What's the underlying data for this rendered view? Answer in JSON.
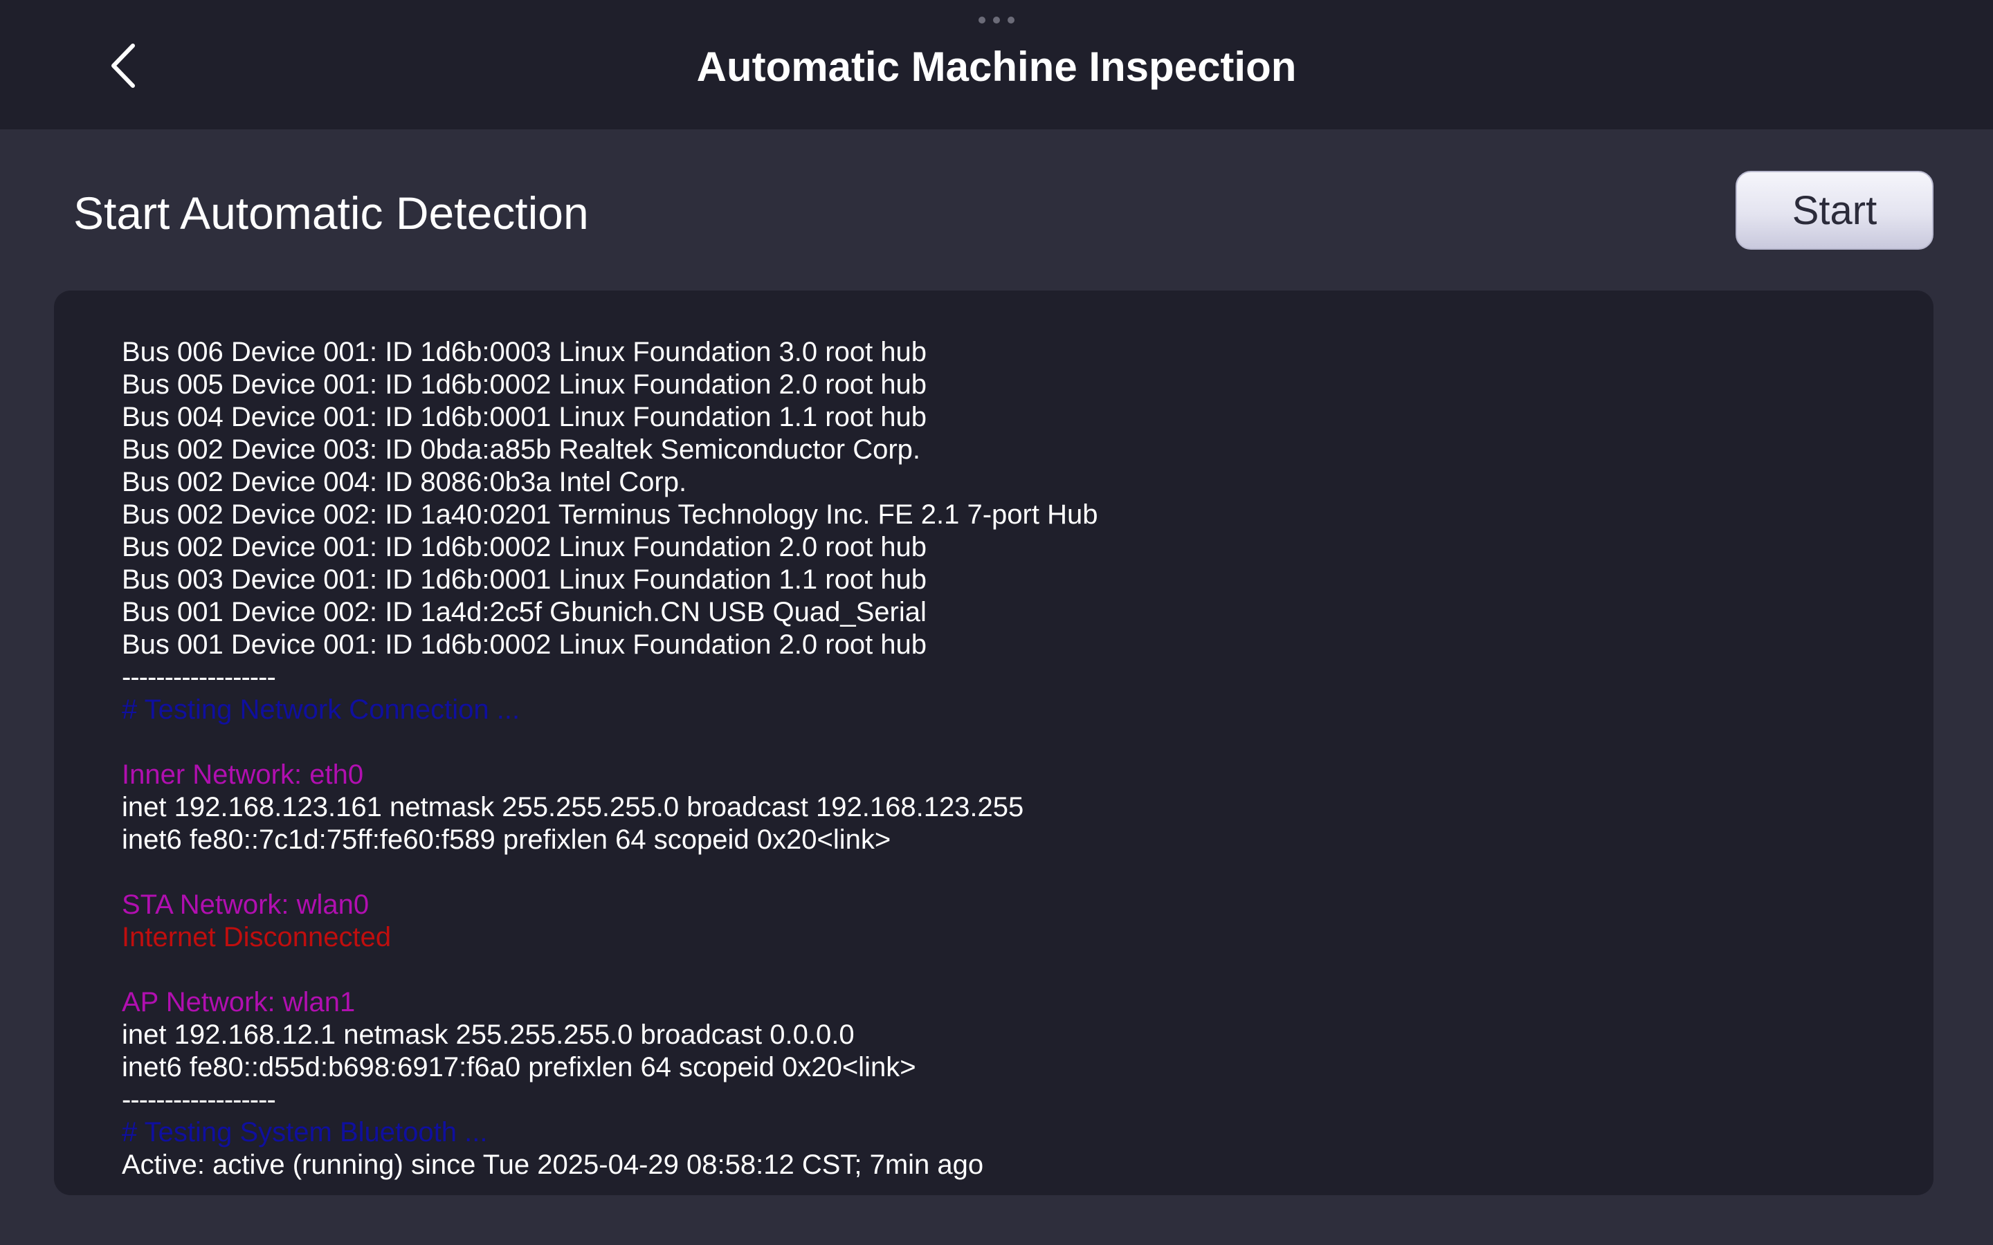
{
  "header": {
    "title": "Automatic Machine Inspection",
    "back_icon": "chevron-left-icon"
  },
  "detection": {
    "heading": "Start Automatic Detection",
    "start_label": "Start"
  },
  "console": {
    "usb_lines": [
      "Bus 006 Device 001: ID 1d6b:0003 Linux Foundation 3.0 root hub",
      "Bus 005 Device 001: ID 1d6b:0002 Linux Foundation 2.0 root hub",
      "Bus 004 Device 001: ID 1d6b:0001 Linux Foundation 1.1 root hub",
      "Bus 002 Device 003: ID 0bda:a85b Realtek Semiconductor Corp.",
      "Bus 002 Device 004: ID 8086:0b3a Intel Corp.",
      "Bus 002 Device 002: ID 1a40:0201 Terminus Technology Inc. FE 2.1 7-port Hub",
      "Bus 002 Device 001: ID 1d6b:0002 Linux Foundation 2.0 root hub",
      "Bus 003 Device 001: ID 1d6b:0001 Linux Foundation 1.1 root hub",
      "Bus 001 Device 002: ID 1a4d:2c5f Gbunich.CN USB Quad_Serial",
      "Bus 001 Device 001: ID 1d6b:0002 Linux Foundation 2.0 root hub"
    ],
    "separator_1": "------------------",
    "network_heading": "# Testing Network Connection ...",
    "inner_network_label": "Inner Network: eth0",
    "inner_inet": "inet 192.168.123.161 netmask 255.255.255.0 broadcast 192.168.123.255",
    "inner_inet6": "inet6 fe80::7c1d:75ff:fe60:f589 prefixlen 64 scopeid 0x20<link>",
    "sta_network_label": "STA Network: wlan0",
    "sta_status": "Internet Disconnected",
    "ap_network_label": "AP Network: wlan1",
    "ap_inet": "inet 192.168.12.1 netmask 255.255.255.0 broadcast 0.0.0.0",
    "ap_inet6": "inet6 fe80::d55d:b698:6917:f6a0 prefixlen 64 scopeid 0x20<link>",
    "separator_2": "------------------",
    "bluetooth_heading": "# Testing System Bluetooth ...",
    "bluetooth_status": "Active: active (running) since Tue 2025-04-29 08:58:12 CST; 7min ago"
  },
  "colors": {
    "heading_blue": "#0f0f9e",
    "network_magenta": "#b10fb0",
    "error_red": "#c00e0e"
  }
}
